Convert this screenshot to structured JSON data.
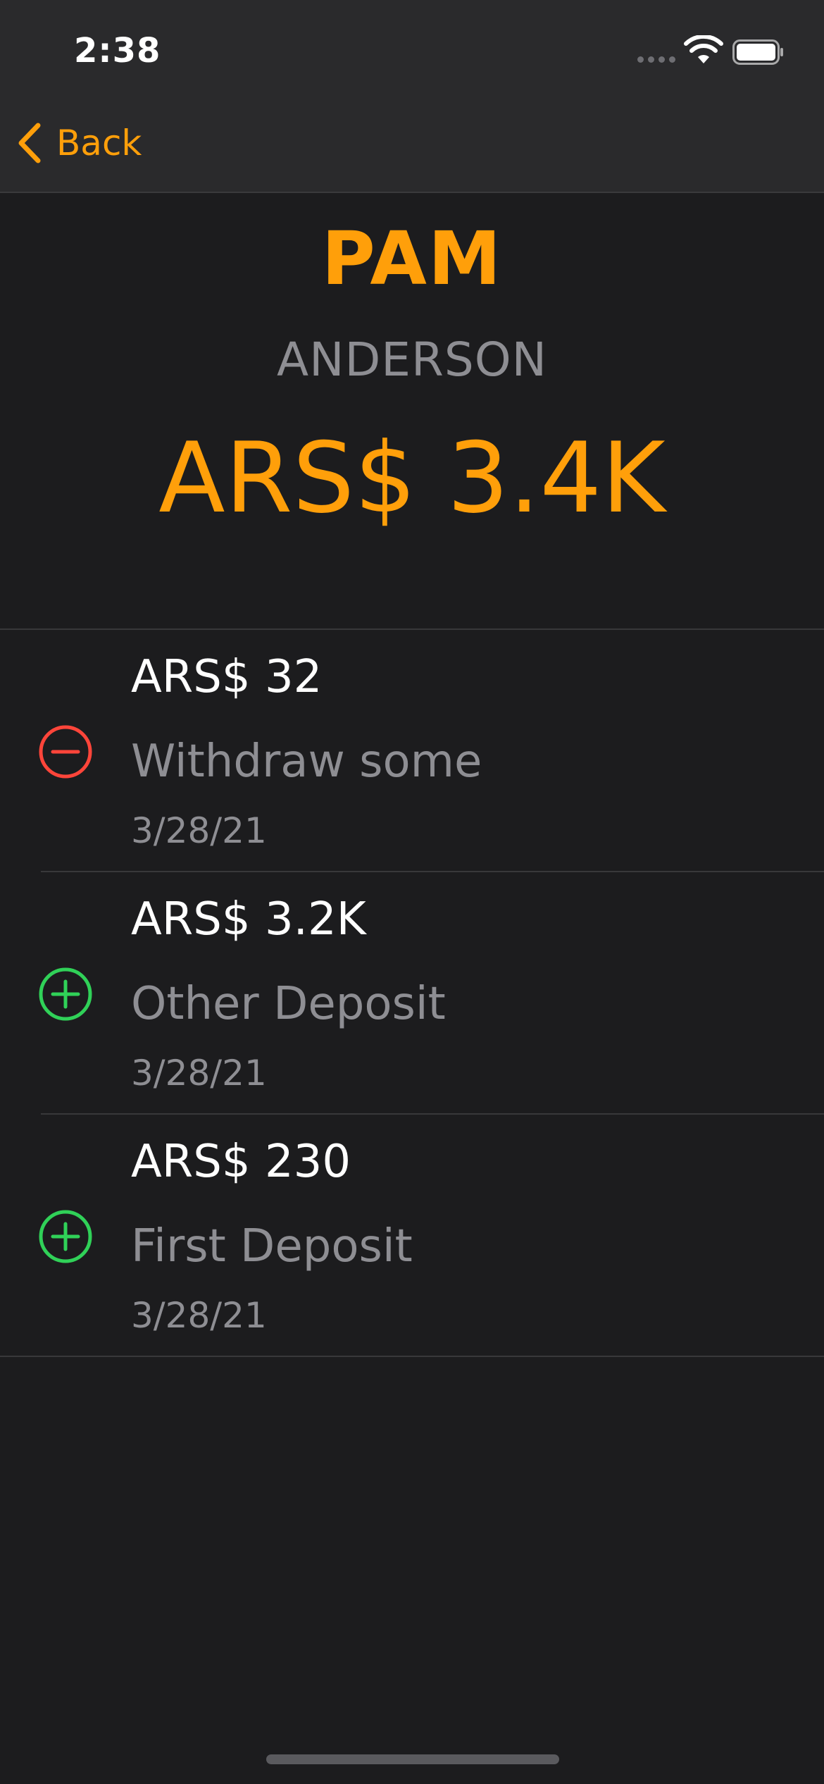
{
  "status_bar": {
    "time": "2:38",
    "icons": [
      "cellular-signal-icon",
      "wifi-icon",
      "battery-icon"
    ]
  },
  "nav": {
    "back_label": "Back",
    "back_icon": "chevron-left-icon"
  },
  "account": {
    "first_name": "PAM",
    "last_name": "ANDERSON",
    "balance": "ARS$ 3.4K"
  },
  "colors": {
    "accent": "#ff9f0a",
    "withdraw": "#ff453a",
    "deposit": "#30d158",
    "background": "#1c1c1e",
    "secondary_text": "#8e8e93"
  },
  "transactions": [
    {
      "type": "withdraw",
      "icon": "minus-circle-icon",
      "amount": "ARS$ 32",
      "description": "Withdraw some",
      "date": "3/28/21"
    },
    {
      "type": "deposit",
      "icon": "plus-circle-icon",
      "amount": "ARS$ 3.2K",
      "description": "Other Deposit",
      "date": "3/28/21"
    },
    {
      "type": "deposit",
      "icon": "plus-circle-icon",
      "amount": "ARS$ 230",
      "description": "First Deposit",
      "date": "3/28/21"
    }
  ]
}
